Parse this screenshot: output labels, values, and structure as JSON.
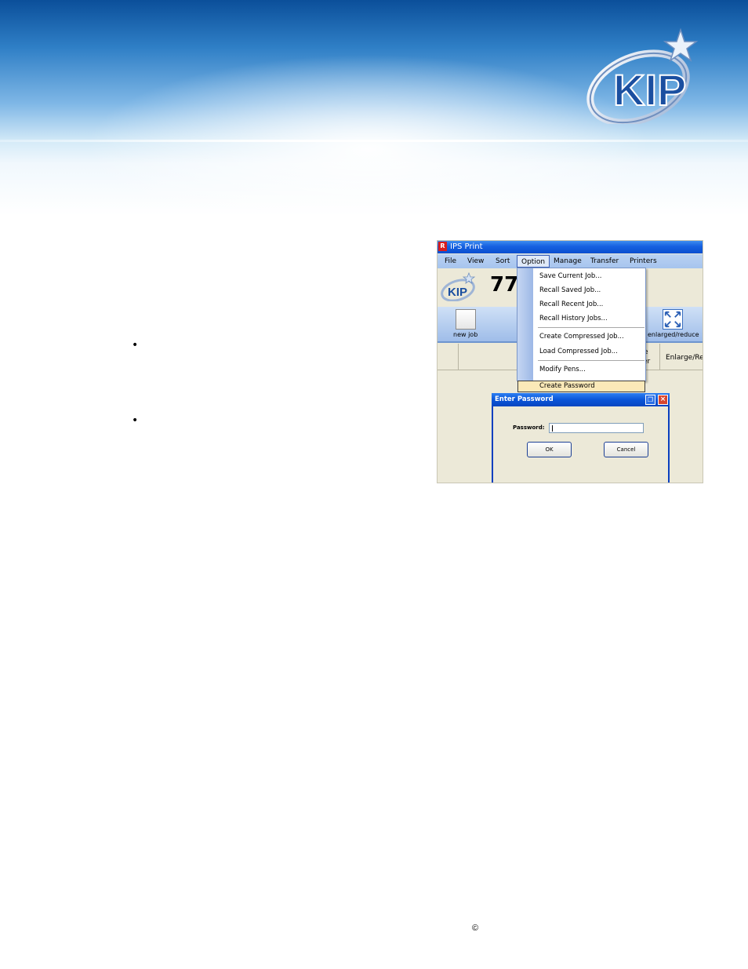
{
  "header": {
    "logo_text": "KIP",
    "colors": {
      "banner_top": "#0b4f9a",
      "banner_mid": "#7fb7e6",
      "logo_blue": "#1b4fa0"
    }
  },
  "bullets": [
    "•",
    "•"
  ],
  "screenshot": {
    "window_title": "IPS Print",
    "menu": [
      "File",
      "View",
      "Sort",
      "Option",
      "Manage",
      "Transfer",
      "Printers"
    ],
    "job_number": "77",
    "toolbar": {
      "new_job_label": "new job",
      "enlarge_label": "enlarged/reduce"
    },
    "header_fragments": {
      "partial_top": "e",
      "partial_bottom": "er",
      "enlarge_col": "Enlarge/Red"
    },
    "option_menu_items": [
      "Save Current Job...",
      "Recall Saved Job...",
      "Recall Recent Job...",
      "Recall History Jobs...",
      "Create Compressed Job...",
      "Load Compressed Job...",
      "Modify Pens...",
      "Create Password"
    ],
    "dialog": {
      "title": "Enter Password",
      "password_label": "Password:",
      "password_value": "",
      "ok_label": "OK",
      "cancel_label": "Cancel"
    }
  },
  "footer": {
    "copyright": "©"
  }
}
